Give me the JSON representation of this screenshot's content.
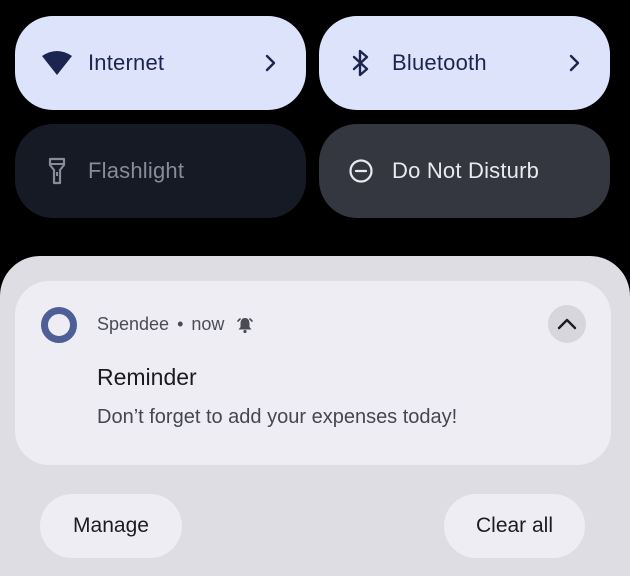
{
  "quick_settings": {
    "tiles": [
      {
        "label": "Internet",
        "icon": "wifi-icon",
        "state": "on",
        "has_chevron": true
      },
      {
        "label": "Bluetooth",
        "icon": "bluetooth-icon",
        "state": "on",
        "has_chevron": true
      },
      {
        "label": "Flashlight",
        "icon": "flashlight-icon",
        "state": "off"
      },
      {
        "label": "Do Not Disturb",
        "icon": "do-not-disturb-icon",
        "state": "off"
      }
    ]
  },
  "notification": {
    "app_name": "Spendee",
    "separator": "•",
    "time": "now",
    "alert_icon": "bell-icon",
    "title": "Reminder",
    "body": "Don’t forget to add your expenses today!",
    "expanded": true
  },
  "actions": {
    "manage_label": "Manage",
    "clear_all_label": "Clear all"
  },
  "colors": {
    "tile_on_bg": "#dde3fb",
    "tile_on_fg": "#1b2550",
    "tile_off_bg": "#151a25",
    "dnd_tile_bg": "#343640",
    "shade_bg": "#dedde3",
    "card_bg": "#eeedf3",
    "app_icon_color": "#4e5f97"
  }
}
